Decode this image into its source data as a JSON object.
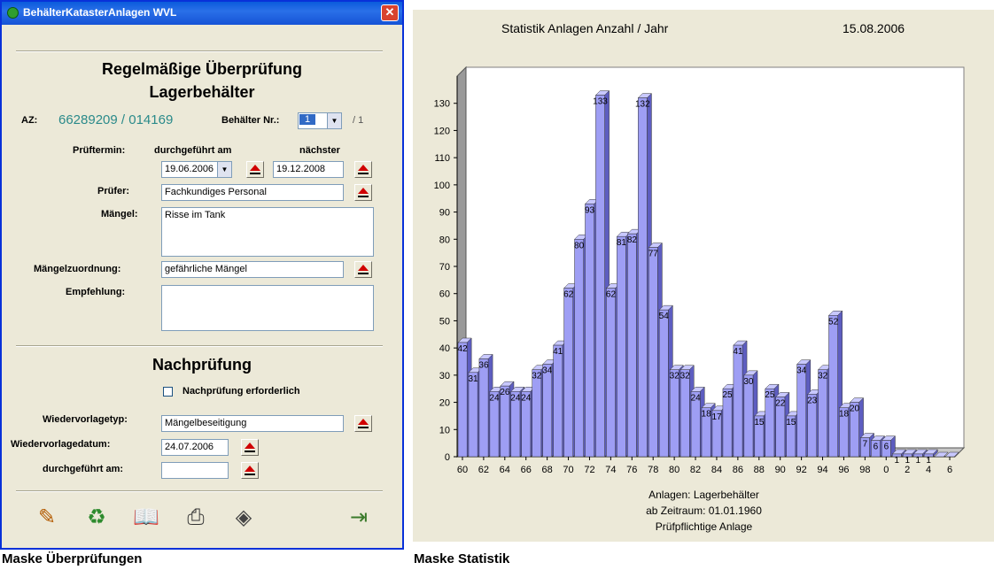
{
  "window": {
    "title": "BehälterKatasterAnlagen WVL",
    "close_glyph": "✕"
  },
  "form": {
    "heading_line1": "Regelmäßige Überprüfung",
    "heading_line2": "Lagerbehälter",
    "az_label": "AZ:",
    "az_value": "66289209 / 014169",
    "behaelter_label": "Behälter Nr.:",
    "behaelter_value": "1",
    "behaelter_total": "/ 1",
    "prueftermin_label": "Prüftermin:",
    "durchgefuehrt_label": "durchgeführt am",
    "naechster_label": "nächster",
    "durchgefuehrt_value": "19.06.2006",
    "naechster_value": "19.12.2008",
    "pruefer_label": "Prüfer:",
    "pruefer_value": "Fachkundiges Personal",
    "maengel_label": "Mängel:",
    "maengel_value": "Risse im Tank",
    "zuordnung_label": "Mängelzuordnung:",
    "zuordnung_value": "gefährliche Mängel",
    "empfehlung_label": "Empfehlung:",
    "empfehlung_value": ""
  },
  "nachpruefung": {
    "heading": "Nachprüfung",
    "checkbox_label": "Nachprüfung erforderlich",
    "checkbox_checked": false,
    "typ_label": "Wiedervorlagetyp:",
    "typ_value": "Mängelbeseitigung",
    "datum_label": "Wiedervorlagedatum:",
    "datum_value": "24.07.2006",
    "durchgefuehrt_label": "durchgeführt am:",
    "durchgefuehrt_value": ""
  },
  "toolbar": {
    "icons": [
      "pencil-icon",
      "trash-icon",
      "book-icon",
      "printer-icon",
      "eraser-icon",
      "exit-door-icon"
    ]
  },
  "stat": {
    "title": "Statistik Anlagen Anzahl / Jahr",
    "date": "15.08.2006",
    "footer_line1": "Anlagen:  Lagerbehälter",
    "footer_line2": "ab Zeitraum:  01.01.1960",
    "footer_line3": "Prüfpflichtige Anlage"
  },
  "captions": {
    "left": "Maske Überprüfungen",
    "right": "Maske Statistik"
  },
  "colors": {
    "bar_front": "#9e9ef4",
    "bar_side": "#5d5dc0",
    "bar_top": "#c8c8ff",
    "az_value": "#2a8a8a",
    "eject": "#d00000"
  },
  "chart_data": {
    "type": "bar",
    "title": "Statistik Anlagen Anzahl / Jahr",
    "xlabel": "",
    "ylabel": "",
    "ylim": [
      0,
      140
    ],
    "yticks": [
      0,
      10,
      20,
      30,
      40,
      50,
      60,
      70,
      80,
      90,
      100,
      110,
      120,
      130
    ],
    "x_tick_labels": [
      "60",
      "62",
      "64",
      "66",
      "68",
      "70",
      "72",
      "74",
      "76",
      "78",
      "80",
      "82",
      "84",
      "86",
      "88",
      "90",
      "92",
      "94",
      "96",
      "98",
      "0",
      "2",
      "4",
      "6"
    ],
    "categories": [
      "60",
      "61",
      "62",
      "63",
      "64",
      "65",
      "66",
      "67",
      "68",
      "69",
      "70",
      "71",
      "72",
      "73",
      "74",
      "75",
      "76",
      "77",
      "78",
      "79",
      "80",
      "81",
      "82",
      "83",
      "84",
      "85",
      "86",
      "87",
      "88",
      "89",
      "90",
      "91",
      "92",
      "93",
      "94",
      "95",
      "96",
      "97",
      "98",
      "99",
      "0",
      "1",
      "2",
      "3",
      "4",
      "5",
      "6"
    ],
    "values": [
      42,
      31,
      36,
      24,
      26,
      24,
      24,
      32,
      34,
      41,
      62,
      80,
      93,
      133,
      62,
      81,
      82,
      132,
      77,
      54,
      32,
      32,
      24,
      18,
      17,
      25,
      41,
      30,
      15,
      25,
      22,
      15,
      34,
      23,
      32,
      52,
      18,
      20,
      7,
      6,
      6,
      1,
      1,
      1,
      1,
      0,
      0
    ],
    "grid": false,
    "legend": "none"
  }
}
